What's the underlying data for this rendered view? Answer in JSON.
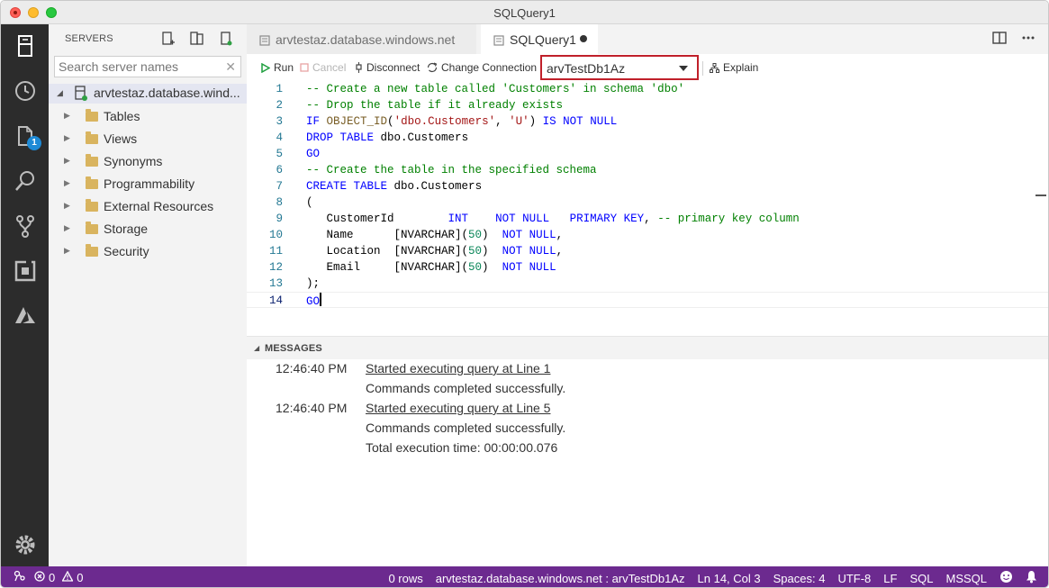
{
  "window": {
    "title": "SQLQuery1"
  },
  "activity_bar": {
    "items": [
      {
        "icon": "servers-icon"
      },
      {
        "icon": "history-icon"
      },
      {
        "icon": "explorer-icon",
        "badge": "1"
      },
      {
        "icon": "search-icon"
      },
      {
        "icon": "source-control-icon"
      },
      {
        "icon": "extensions-icon"
      },
      {
        "icon": "azure-icon"
      }
    ],
    "settings_icon": "gear-icon"
  },
  "sidebar": {
    "title": "SERVERS",
    "search_placeholder": "Search server names",
    "server": "arvtestaz.database.wind...",
    "tree": [
      {
        "label": "Tables"
      },
      {
        "label": "Views"
      },
      {
        "label": "Synonyms"
      },
      {
        "label": "Programmability"
      },
      {
        "label": "External Resources"
      },
      {
        "label": "Storage"
      },
      {
        "label": "Security"
      }
    ]
  },
  "tabs": [
    {
      "label": "arvtestaz.database.windows.net"
    },
    {
      "label": "SQLQuery1"
    }
  ],
  "toolbar": {
    "run": "Run",
    "cancel": "Cancel",
    "disconnect": "Disconnect",
    "change_connection": "Change Connection",
    "database": "arvTestDb1Az",
    "explain": "Explain"
  },
  "code_lines": [
    {
      "num": "1",
      "text": "-- Create a new table called 'Customers' in schema 'dbo'"
    },
    {
      "num": "2",
      "text": "-- Drop the table if it already exists"
    },
    {
      "num": "3",
      "text": "IF OBJECT_ID('dbo.Customers', 'U') IS NOT NULL"
    },
    {
      "num": "4",
      "text": "DROP TABLE dbo.Customers"
    },
    {
      "num": "5",
      "text": "GO"
    },
    {
      "num": "6",
      "text": "-- Create the table in the specified schema"
    },
    {
      "num": "7",
      "text": "CREATE TABLE dbo.Customers"
    },
    {
      "num": "8",
      "text": "("
    },
    {
      "num": "9",
      "text": "   CustomerId        INT    NOT NULL   PRIMARY KEY, -- primary key column"
    },
    {
      "num": "10",
      "text": "   Name      [NVARCHAR](50)  NOT NULL,"
    },
    {
      "num": "11",
      "text": "   Location  [NVARCHAR](50)  NOT NULL,"
    },
    {
      "num": "12",
      "text": "   Email     [NVARCHAR](50)  NOT NULL"
    },
    {
      "num": "13",
      "text": ");"
    },
    {
      "num": "14",
      "text": "GO"
    }
  ],
  "messages": {
    "title": "MESSAGES",
    "entries": [
      {
        "time": "12:46:40 PM",
        "text": "Started executing query at Line 1"
      },
      {
        "time": "",
        "text": "Commands completed successfully."
      },
      {
        "time": "12:46:40 PM",
        "text": "Started executing query at Line 5"
      },
      {
        "time": "",
        "text": "Commands completed successfully."
      },
      {
        "time": "",
        "text": "Total execution time: 00:00:00.076"
      }
    ]
  },
  "status_bar": {
    "errors": "0",
    "warnings": "0",
    "rows": "0 rows",
    "connection": "arvtestaz.database.windows.net : arvTestDb1Az",
    "position": "Ln 14, Col 3",
    "spaces": "Spaces: 4",
    "encoding": "UTF-8",
    "eol": "LF",
    "language": "SQL",
    "provider": "MSSQL"
  },
  "colors": {
    "status_bar": "#6c2a8f",
    "activity_bar": "#2c2c2c",
    "highlight_border": "#c0202a"
  }
}
